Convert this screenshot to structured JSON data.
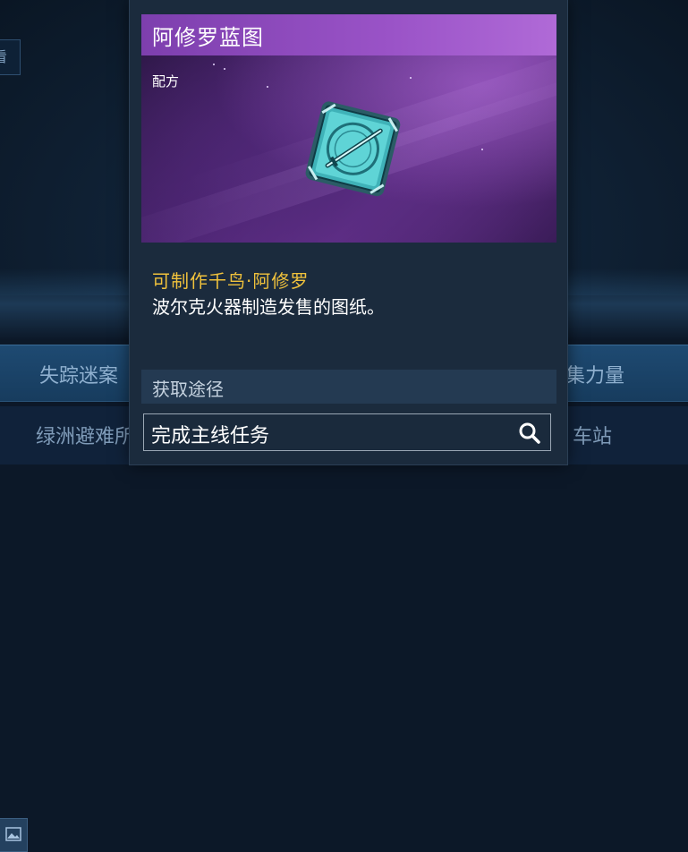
{
  "background": {
    "side_button_label": "看",
    "tabs": [
      "失踪迷案",
      "集力量"
    ],
    "row_labels": [
      "绿洲避难所",
      "车站"
    ]
  },
  "card": {
    "title": "阿修罗蓝图",
    "category": "配方",
    "item_icon": "blueprint-sword-icon",
    "craft_text": "可制作千鸟·阿修罗",
    "description": "波尔克火器制造发售的图纸。",
    "source_heading": "获取途径",
    "sources": [
      {
        "label": "完成主线任务",
        "icon": "search-icon"
      }
    ]
  },
  "colors": {
    "header_purple": "#9a53c7",
    "craft_gold": "#f0c23c",
    "panel_bg": "#1b2b3d",
    "icon_teal": "#5fd4d6"
  }
}
